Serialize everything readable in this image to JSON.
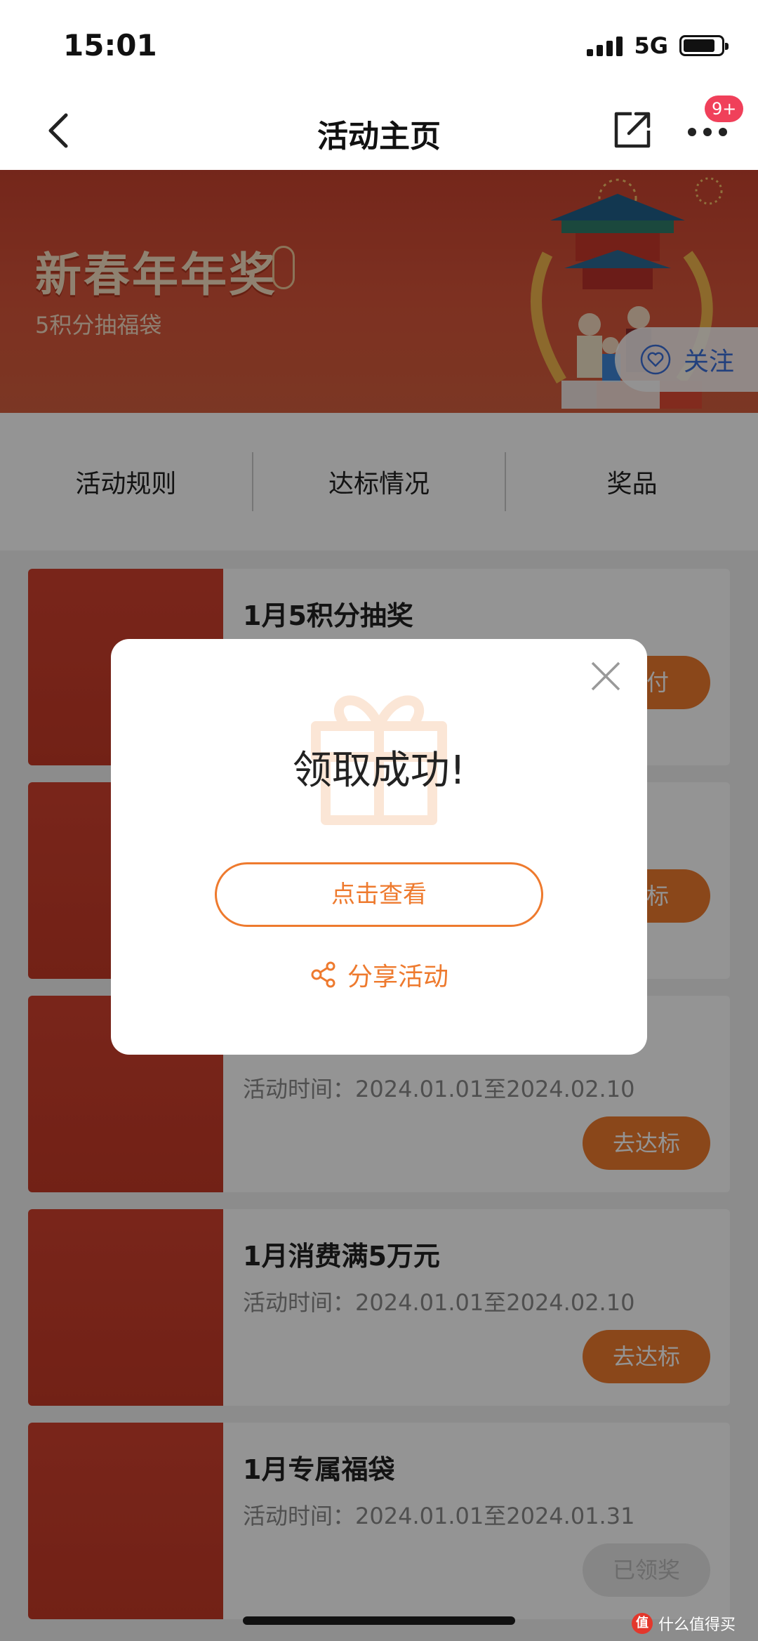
{
  "status_bar": {
    "time": "15:01",
    "network": "5G"
  },
  "nav": {
    "title": "活动主页",
    "badge": "9+"
  },
  "banner": {
    "title": "新春年年奖",
    "subtitle": "5积分抽福袋",
    "follow_label": "关注"
  },
  "tabs": [
    {
      "label": "活动规则"
    },
    {
      "label": "达标情况"
    },
    {
      "label": "奖品"
    }
  ],
  "activities": [
    {
      "title": "1月5积分抽奖",
      "time": "",
      "button": "支付"
    },
    {
      "title": "",
      "time": "",
      "button": "达标"
    },
    {
      "title": "",
      "time": "活动时间：2024.01.01至2024.02.10",
      "button": "去达标"
    },
    {
      "title": "1月消费满5万元",
      "time": "活动时间：2024.01.01至2024.02.10",
      "button": "去达标"
    },
    {
      "title": "1月专属福袋",
      "time": "活动时间：2024.01.01至2024.01.31",
      "button": "已领奖"
    }
  ],
  "modal": {
    "title": "领取成功!",
    "view_button": "点击查看",
    "share_label": "分享活动"
  },
  "watermark": {
    "text": "什么值得买",
    "logo": "值"
  },
  "colors": {
    "accent": "#ee7a2e",
    "banner_red": "#d0482f",
    "badge": "#f0405a",
    "follow_blue": "#3b6fd8"
  }
}
